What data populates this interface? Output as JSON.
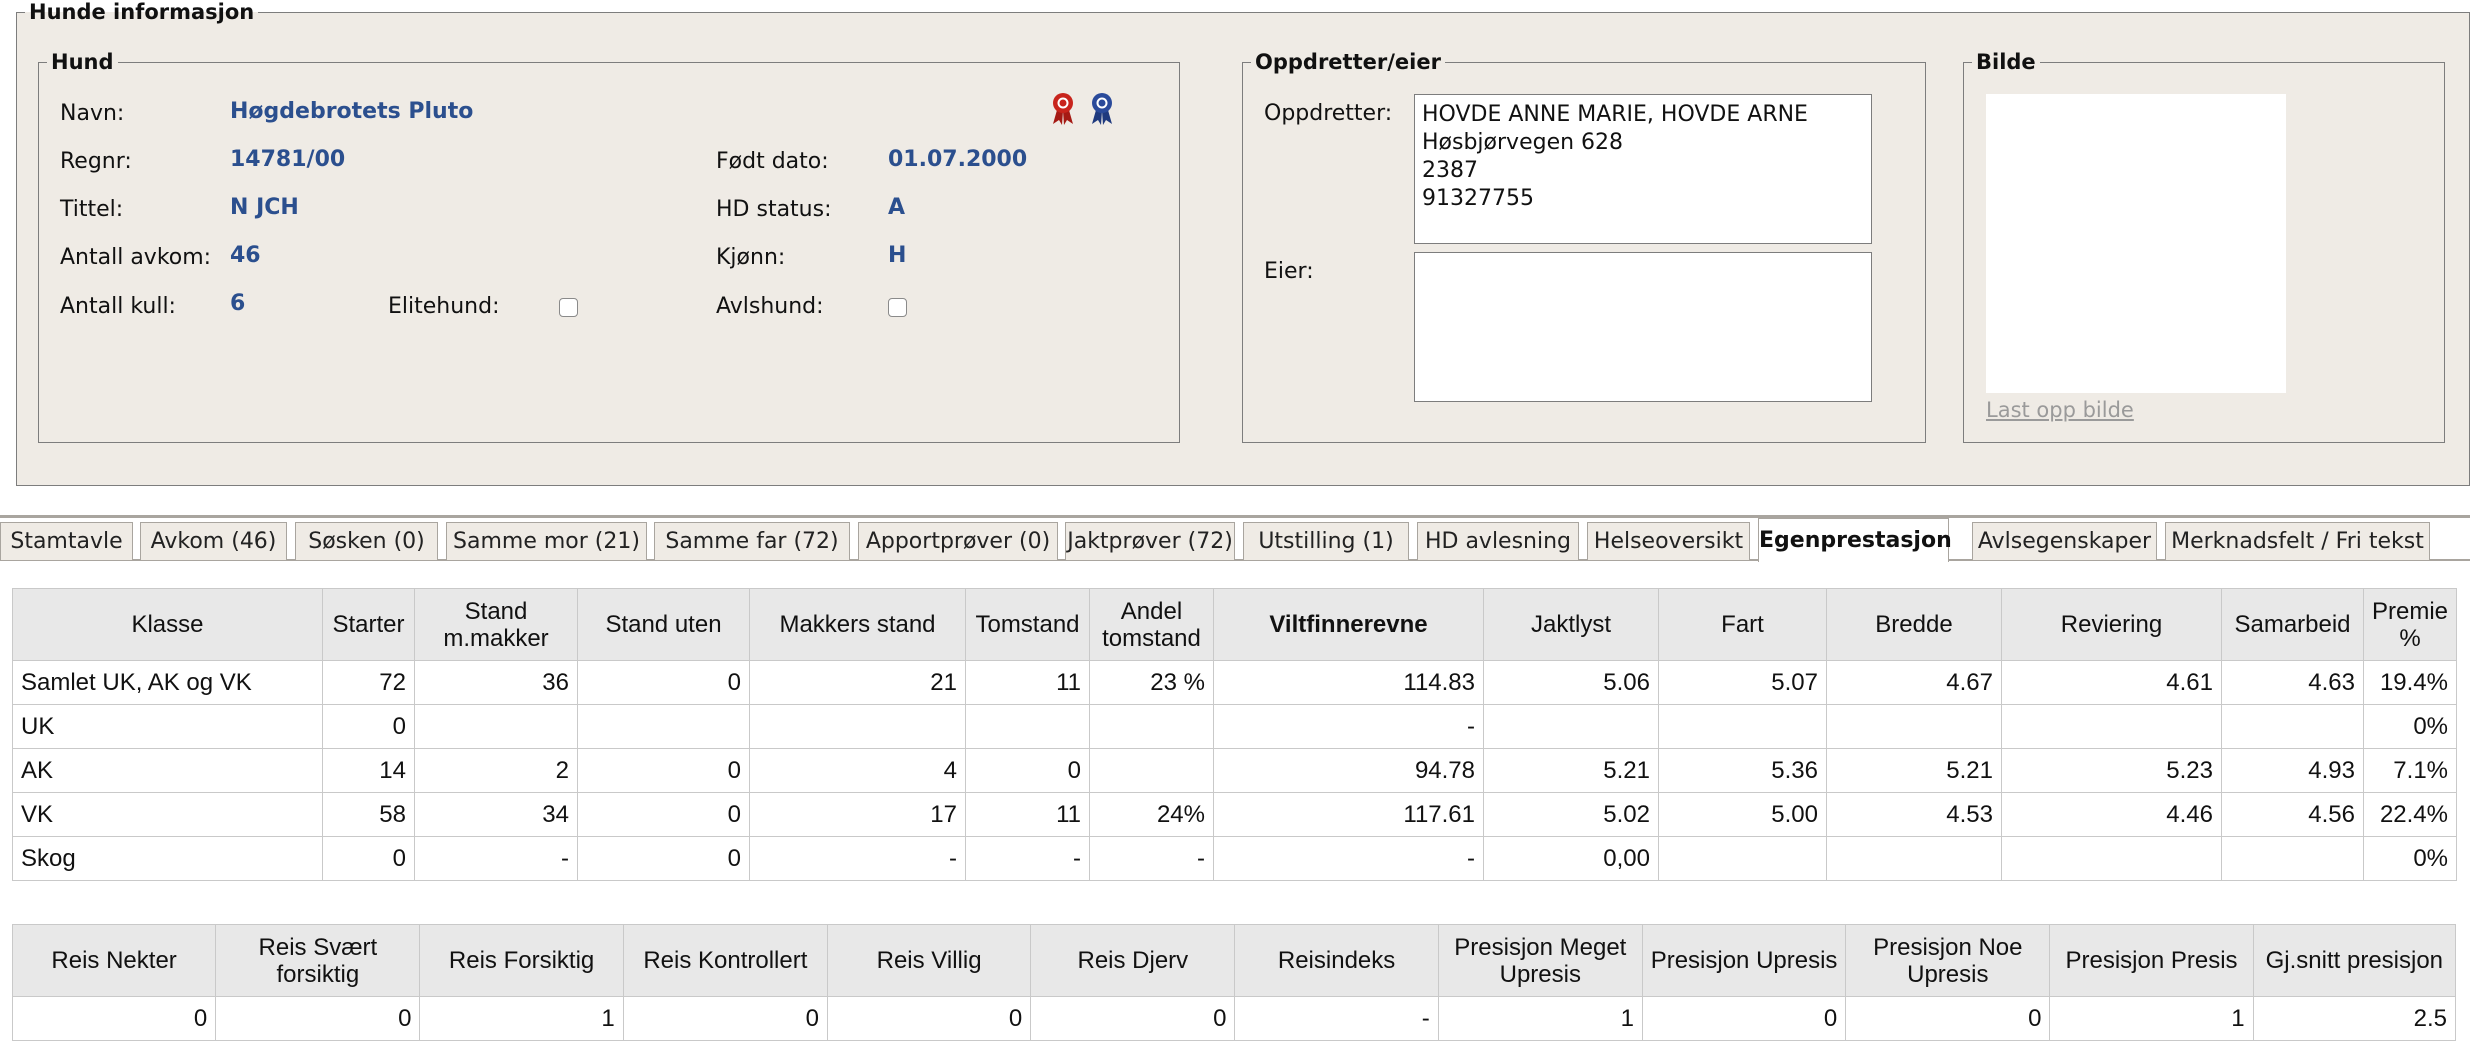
{
  "hunde_informasjon": {
    "legend": "Hunde informasjon",
    "hund": {
      "legend": "Hund",
      "navn_label": "Navn:",
      "navn": "Høgdebrotets Pluto",
      "regnr_label": "Regnr:",
      "regnr": "14781/00",
      "fodt_label": "Født dato:",
      "fodt": "01.07.2000",
      "tittel_label": "Tittel:",
      "tittel": "N JCH",
      "hd_label": "HD status:",
      "hd": "A",
      "avkom_label": "Antall avkom:",
      "avkom": "46",
      "kjonn_label": "Kjønn:",
      "kjonn": "H",
      "kull_label": "Antall kull:",
      "kull": "6",
      "elitehund_label": "Elitehund:",
      "avlshund_label": "Avlshund:",
      "ribbon_colors": [
        "#c8241c",
        "#2a4a9a"
      ]
    },
    "oppdretter_eier": {
      "legend": "Oppdretter/eier",
      "oppdretter_label": "Oppdretter:",
      "oppdretter_lines": [
        "HOVDE ANNE MARIE, HOVDE ARNE",
        "Høsbjørvegen 628",
        "2387",
        "91327755"
      ],
      "eier_label": "Eier:"
    },
    "bilde": {
      "legend": "Bilde",
      "upload_link": "Last opp bilde"
    }
  },
  "tabs": [
    {
      "label": "Stamtavle",
      "active": false
    },
    {
      "label": "Avkom (46)",
      "active": false
    },
    {
      "label": "Søsken (0)",
      "active": false
    },
    {
      "label": "Samme mor (21)",
      "active": false
    },
    {
      "label": "Samme far (72)",
      "active": false
    },
    {
      "label": "Apportprøver (0)",
      "active": false
    },
    {
      "label": "Jaktprøver (72)",
      "active": false
    },
    {
      "label": "Utstilling (1)",
      "active": false
    },
    {
      "label": "HD avlesning",
      "active": false
    },
    {
      "label": "Helseoversikt",
      "active": false
    },
    {
      "label": "Egenprestasjon",
      "active": true
    },
    {
      "label": "Avlsegenskaper",
      "active": false
    },
    {
      "label": "Merknadsfelt / Fri tekst",
      "active": false
    }
  ],
  "egenprestasjon": {
    "headers": [
      "Klasse",
      "Starter",
      "Stand m.makker",
      "Stand uten",
      "Makkers stand",
      "Tomstand",
      "Andel tomstand",
      "Viltfinnerevne",
      "Jaktlyst",
      "Fart",
      "Bredde",
      "Reviering",
      "Samarbeid",
      "Premie %"
    ],
    "rows": [
      [
        "Samlet UK, AK og VK",
        "72",
        "36",
        "0",
        "21",
        "11",
        "23 %",
        "114.83",
        "5.06",
        "5.07",
        "4.67",
        "4.61",
        "4.63",
        "19.4%"
      ],
      [
        "UK",
        "0",
        "",
        "",
        "",
        "",
        "",
        "-",
        "",
        "",
        "",
        "",
        "",
        "0%"
      ],
      [
        "AK",
        "14",
        "2",
        "0",
        "4",
        "0",
        "",
        "94.78",
        "5.21",
        "5.36",
        "5.21",
        "5.23",
        "4.93",
        "7.1%"
      ],
      [
        "VK",
        "58",
        "34",
        "0",
        "17",
        "11",
        "24%",
        "117.61",
        "5.02",
        "5.00",
        "4.53",
        "4.46",
        "4.56",
        "22.4%"
      ],
      [
        "Skog",
        "0",
        "-",
        "0",
        "-",
        "-",
        "-",
        "-",
        "0,00",
        "",
        "",
        "",
        "",
        "0%"
      ]
    ]
  },
  "reis": {
    "headers": [
      "Reis Nekter",
      "Reis Svært forsiktig",
      "Reis Forsiktig",
      "Reis Kontrollert",
      "Reis Villig",
      "Reis Djerv",
      "Reisindeks",
      "Presisjon Meget Upresis",
      "Presisjon Upresis",
      "Presisjon Noe Upresis",
      "Presisjon Presis",
      "Gj.snitt presisjon"
    ],
    "rows": [
      [
        "0",
        "0",
        "1",
        "0",
        "0",
        "0",
        "-",
        "1",
        "0",
        "0",
        "1",
        "2.5"
      ]
    ]
  }
}
